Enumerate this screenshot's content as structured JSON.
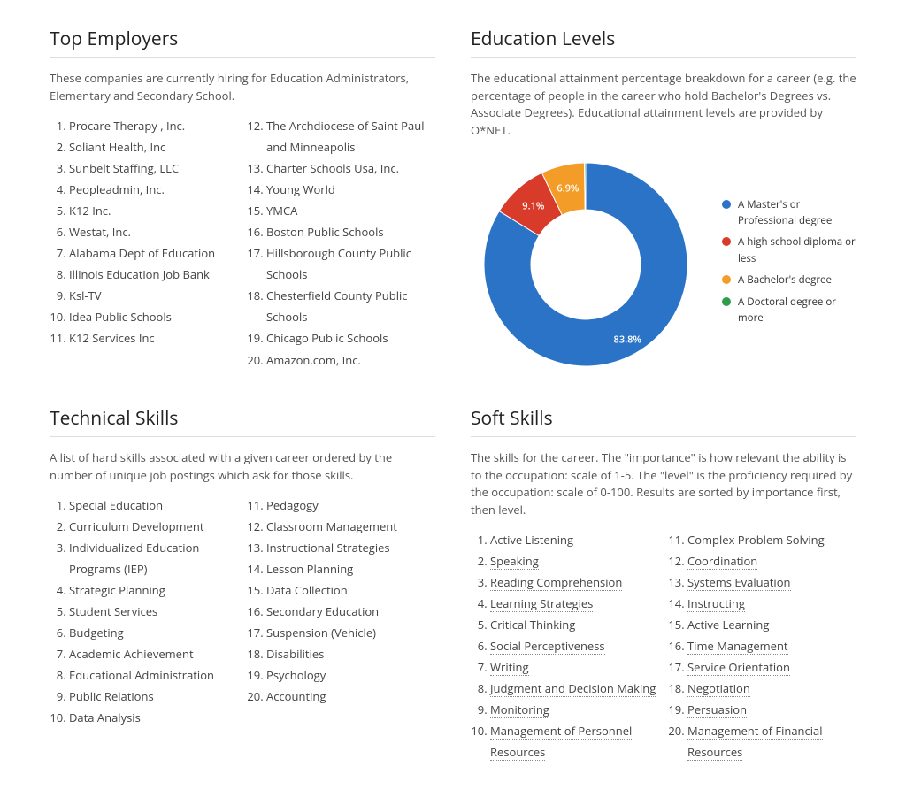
{
  "top_employers": {
    "title": "Top Employers",
    "intro": "These companies are currently hiring for Education Administrators, Elementary and Secondary School.",
    "items": [
      "Procare Therapy , Inc.",
      "Soliant Health, Inc",
      "Sunbelt Staffing, LLC",
      "Peopleadmin, Inc.",
      "K12 Inc.",
      "Westat, Inc.",
      "Alabama Dept of Education",
      "Illinois Education Job Bank",
      "Ksl-TV",
      "Idea Public Schools",
      "K12 Services Inc",
      "The Archdiocese of Saint Paul and Minneapolis",
      "Charter Schools Usa, Inc.",
      "Young World",
      "YMCA",
      "Boston Public Schools",
      "Hillsborough County Public Schools",
      "Chesterfield County Public Schools",
      "Chicago Public Schools",
      "Amazon.com, Inc."
    ]
  },
  "education_levels": {
    "title": "Education Levels",
    "intro": "The educational attainment percentage breakdown for a career (e.g. the percentage of people in the career who hold Bachelor's Degrees vs. Associate Degrees). Educational attainment levels are provided by O*NET."
  },
  "technical_skills": {
    "title": "Technical Skills",
    "intro": "A list of hard skills associated with a given career ordered by the number of unique job postings which ask for those skills.",
    "items": [
      "Special Education",
      "Curriculum Development",
      "Individualized Education Programs (IEP)",
      "Strategic Planning",
      "Student Services",
      "Budgeting",
      "Academic Achievement",
      "Educational Administration",
      "Public Relations",
      "Data Analysis",
      "Pedagogy",
      "Classroom Management",
      "Instructional Strategies",
      "Lesson Planning",
      "Data Collection",
      "Secondary Education",
      "Suspension (Vehicle)",
      "Disabilities",
      "Psychology",
      "Accounting"
    ]
  },
  "soft_skills": {
    "title": "Soft Skills",
    "intro": "The skills for the career. The \"importance\" is how relevant the ability is to the occupation: scale of 1-5. The \"level\" is the proficiency required by the occupation: scale of 0-100. Results are sorted by importance first, then level.",
    "items": [
      "Active Listening",
      "Speaking",
      "Reading Comprehension",
      "Learning Strategies",
      "Critical Thinking",
      "Social Perceptiveness",
      "Writing",
      "Judgment and Decision Making",
      "Monitoring",
      "Management of Personnel Resources",
      "Complex Problem Solving",
      "Coordination",
      "Systems Evaluation",
      "Instructing",
      "Active Learning",
      "Time Management",
      "Service Orientation",
      "Negotiation",
      "Persuasion",
      "Management of Financial Resources"
    ]
  },
  "chart_data": {
    "type": "pie",
    "title": "Education Levels",
    "series": [
      {
        "name": "A Master's or Professional degree",
        "value": 83.8,
        "color": "#2b73c7",
        "label": "83.8%"
      },
      {
        "name": "A high school diploma or less",
        "value": 9.1,
        "color": "#d93b2b",
        "label": "9.1%"
      },
      {
        "name": "A Bachelor's degree",
        "value": 6.9,
        "color": "#f39c27",
        "label": "6.9%"
      },
      {
        "name": "A Doctoral degree or more",
        "value": 0.2,
        "color": "#2e9c4b",
        "label": ""
      }
    ]
  }
}
